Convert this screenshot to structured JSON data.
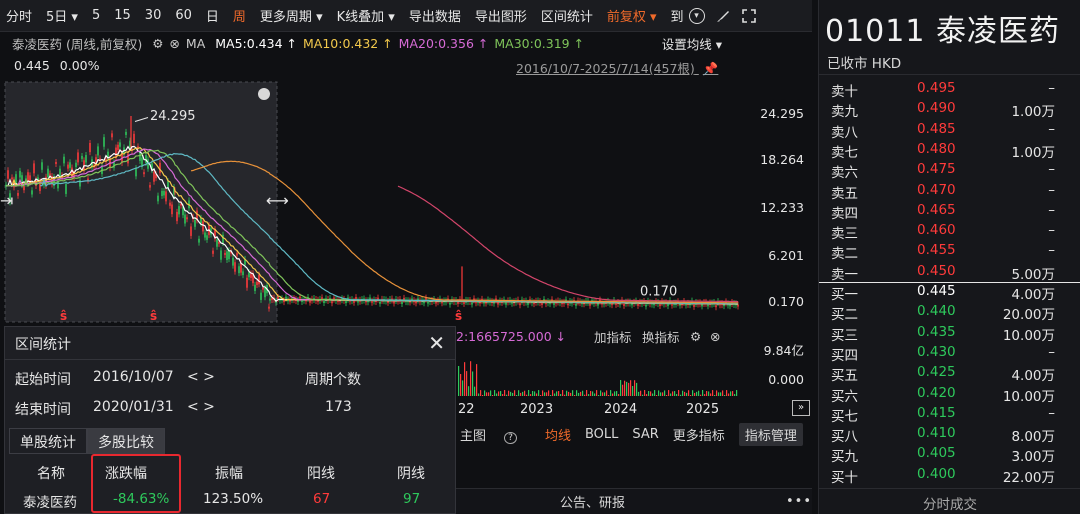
{
  "toolbar": {
    "items": [
      "分时",
      "5日",
      "5",
      "15",
      "30",
      "60",
      "日",
      "周",
      "更多周期",
      "K线叠加",
      "导出数据",
      "导出图形",
      "区间统计",
      "前复权",
      "到"
    ],
    "active_index": 7
  },
  "ma_row": {
    "stock": "泰凌医药 (周线,前复权)",
    "ma_label": "MA",
    "ma5": "MA5:0.434 ↑",
    "ma10": "MA10:0.432 ↑",
    "ma20": "MA20:0.356 ↑",
    "ma30": "MA30:0.319 ↑",
    "settings": "设置均线"
  },
  "info": {
    "price": "0.445",
    "change": "0.00%"
  },
  "range": "2016/10/7-2025/7/14(457根)",
  "price_axis": [
    "24.295",
    "18.264",
    "12.233",
    "6.201",
    "0.170"
  ],
  "annotations": {
    "high": "24.295",
    "low": "0.170"
  },
  "indicator": {
    "header": "2:1665725.000 ↓",
    "add": "加指标",
    "switch": "换指标"
  },
  "vol_axis": [
    "9.84亿",
    "0.000"
  ],
  "years": [
    "22",
    "2023",
    "2024",
    "2025"
  ],
  "ind_toolbar": [
    "主图",
    "均线",
    "BOLL",
    "SAR",
    "更多指标",
    "指标管理"
  ],
  "bottom_strip": "公告、研报",
  "stats": {
    "title": "区间统计",
    "start_label": "起始时间",
    "start": "2016/10/07",
    "end_label": "结束时间",
    "end": "2020/01/31",
    "period_label": "周期个数",
    "period": "173",
    "tab1": "单股统计",
    "tab2": "多股比较",
    "headers": [
      "名称",
      "涨跌幅",
      "振幅",
      "阳线",
      "阴线"
    ],
    "row": [
      "泰凌医药",
      "-84.63%",
      "123.50%",
      "67",
      "97"
    ]
  },
  "quote": {
    "title": "01011 泰凌医药",
    "status": "已收市 HKD",
    "asks": [
      {
        "label": "卖十",
        "price": "0.495",
        "vol": "–"
      },
      {
        "label": "卖九",
        "price": "0.490",
        "vol": "1.00万"
      },
      {
        "label": "卖八",
        "price": "0.485",
        "vol": "–"
      },
      {
        "label": "卖七",
        "price": "0.480",
        "vol": "1.00万"
      },
      {
        "label": "卖六",
        "price": "0.475",
        "vol": "–"
      },
      {
        "label": "卖五",
        "price": "0.470",
        "vol": "–"
      },
      {
        "label": "卖四",
        "price": "0.465",
        "vol": "–"
      },
      {
        "label": "卖三",
        "price": "0.460",
        "vol": "–"
      },
      {
        "label": "卖二",
        "price": "0.455",
        "vol": "–"
      },
      {
        "label": "卖一",
        "price": "0.450",
        "vol": "5.00万"
      }
    ],
    "bids": [
      {
        "label": "买一",
        "price": "0.445",
        "vol": "4.00万"
      },
      {
        "label": "买二",
        "price": "0.440",
        "vol": "20.00万"
      },
      {
        "label": "买三",
        "price": "0.435",
        "vol": "10.00万"
      },
      {
        "label": "买四",
        "price": "0.430",
        "vol": "–"
      },
      {
        "label": "买五",
        "price": "0.425",
        "vol": "4.00万"
      },
      {
        "label": "买六",
        "price": "0.420",
        "vol": "10.00万"
      },
      {
        "label": "买七",
        "price": "0.415",
        "vol": "–"
      },
      {
        "label": "买八",
        "price": "0.410",
        "vol": "8.00万"
      },
      {
        "label": "买九",
        "price": "0.405",
        "vol": "3.00万"
      },
      {
        "label": "买十",
        "price": "0.400",
        "vol": "22.00万"
      }
    ],
    "footer": "分时成交"
  },
  "colors": {
    "up": "#ff3b3b",
    "down": "#2ec95c",
    "ma5": "#ffffff",
    "ma10": "#f2c94c",
    "ma20": "#d66bd6",
    "ma30": "#7fc45a",
    "ma60": "#5fb9c4",
    "ma120": "#e8923a",
    "ma250": "#d2456a",
    "accent": "#f06a2a"
  }
}
